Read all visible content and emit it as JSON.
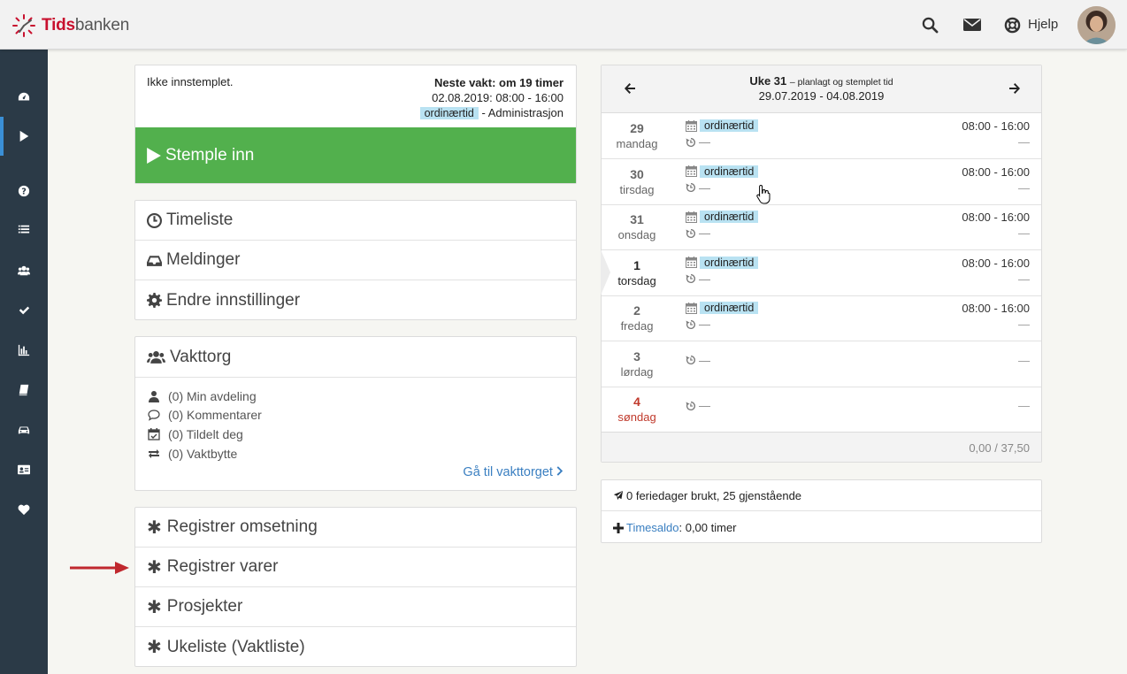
{
  "app": {
    "logo_part1": "Tids",
    "logo_part2": "banken",
    "help_label": "Hjelp"
  },
  "topbar_icons": [
    "search-icon",
    "mail-icon",
    "lifebuoy-icon"
  ],
  "sidebar": {
    "items": [
      "dashboard-icon",
      "play-icon",
      "question-icon",
      "list-icon",
      "users-icon",
      "check-icon",
      "bar-chart-icon",
      "book-icon",
      "car-icon",
      "id-card-icon",
      "heart-icon"
    ],
    "active_index": 1
  },
  "status": {
    "state": "Ikke innstemplet.",
    "next_shift_label": "Neste vakt: om 19 timer",
    "next_shift_time": "02.08.2019: 08:00 - 16:00",
    "shift_tag": "ordinærtid",
    "department": "- Administrasjon",
    "stamp_button": "Stemple inn"
  },
  "menu1": [
    "Timeliste",
    "Meldinger",
    "Endre innstillinger"
  ],
  "vakttorg": {
    "title": "Vakttorg",
    "items": [
      "(0) Min avdeling",
      "(0) Kommentarer",
      "(0) Tildelt deg",
      "(0) Vaktbytte"
    ],
    "link": "Gå til vakttorget"
  },
  "menu2": [
    "Registrer omsetning",
    "Registrer varer",
    "Prosjekter",
    "Ukeliste (Vaktliste)"
  ],
  "calendar": {
    "week_label": "Uke 31",
    "week_sub": "– planlagt og stemplet tid",
    "range": "29.07.2019 - 04.08.2019",
    "days": [
      {
        "num": "29",
        "name": "mandag",
        "tag": "ordinærtid",
        "time": "08:00 - 16:00",
        "hist": "—",
        "dash": "—"
      },
      {
        "num": "30",
        "name": "tirsdag",
        "tag": "ordinærtid",
        "time": "08:00 - 16:00",
        "hist": "—",
        "dash": "—"
      },
      {
        "num": "31",
        "name": "onsdag",
        "tag": "ordinærtid",
        "time": "08:00 - 16:00",
        "hist": "—",
        "dash": "—"
      },
      {
        "num": "1",
        "name": "torsdag",
        "tag": "ordinærtid",
        "time": "08:00 - 16:00",
        "hist": "—",
        "dash": "—"
      },
      {
        "num": "2",
        "name": "fredag",
        "tag": "ordinærtid",
        "time": "08:00 - 16:00",
        "hist": "—",
        "dash": "—"
      },
      {
        "num": "3",
        "name": "lørdag",
        "tag": "",
        "time": "",
        "hist": "—",
        "dash": "—"
      },
      {
        "num": "4",
        "name": "søndag",
        "tag": "",
        "time": "",
        "hist": "—",
        "dash": "—"
      }
    ],
    "total": "0,00 / 37,50"
  },
  "info": {
    "vacation": "0 feriedager brukt, 25 gjenstående",
    "timesaldo_label": "Timesaldo",
    "timesaldo_value": ": 0,00 timer"
  },
  "colors": {
    "brand_red": "#c8102e",
    "sidebar": "#2b3a47",
    "stamp_green": "#52b04d",
    "link_blue": "#3a7fc1",
    "tag_bg": "#b9e2f2",
    "sunday_red": "#c0392b"
  }
}
